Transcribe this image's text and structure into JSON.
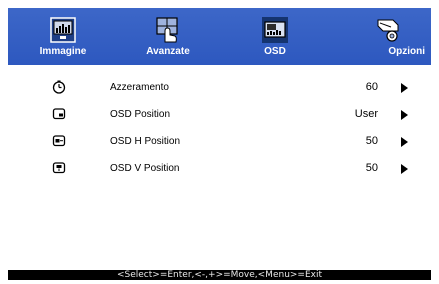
{
  "tabs": [
    {
      "label": "Immagine",
      "icon": "picture-icon",
      "active": false
    },
    {
      "label": "Avanzate",
      "icon": "advanced-icon",
      "active": false
    },
    {
      "label": "OSD",
      "icon": "osd-icon",
      "active": true
    },
    {
      "label": "Opzioni",
      "icon": "options-icon",
      "active": false
    }
  ],
  "rows": [
    {
      "label": "Azzeramento",
      "value": "60",
      "icon": "timer-icon"
    },
    {
      "label": "OSD Position",
      "value": "User",
      "icon": "osd-position-icon"
    },
    {
      "label": "OSD H Position",
      "value": "50",
      "icon": "osd-h-position-icon"
    },
    {
      "label": "OSD V Position",
      "value": "50",
      "icon": "osd-v-position-icon"
    }
  ],
  "statusbar": {
    "text": "<Select>=Enter,<-,+>=Move,<Menu>=Exit"
  },
  "colors": {
    "header": "#2d58bf",
    "active_tab": "#15346f",
    "statusbar": "#000000"
  }
}
